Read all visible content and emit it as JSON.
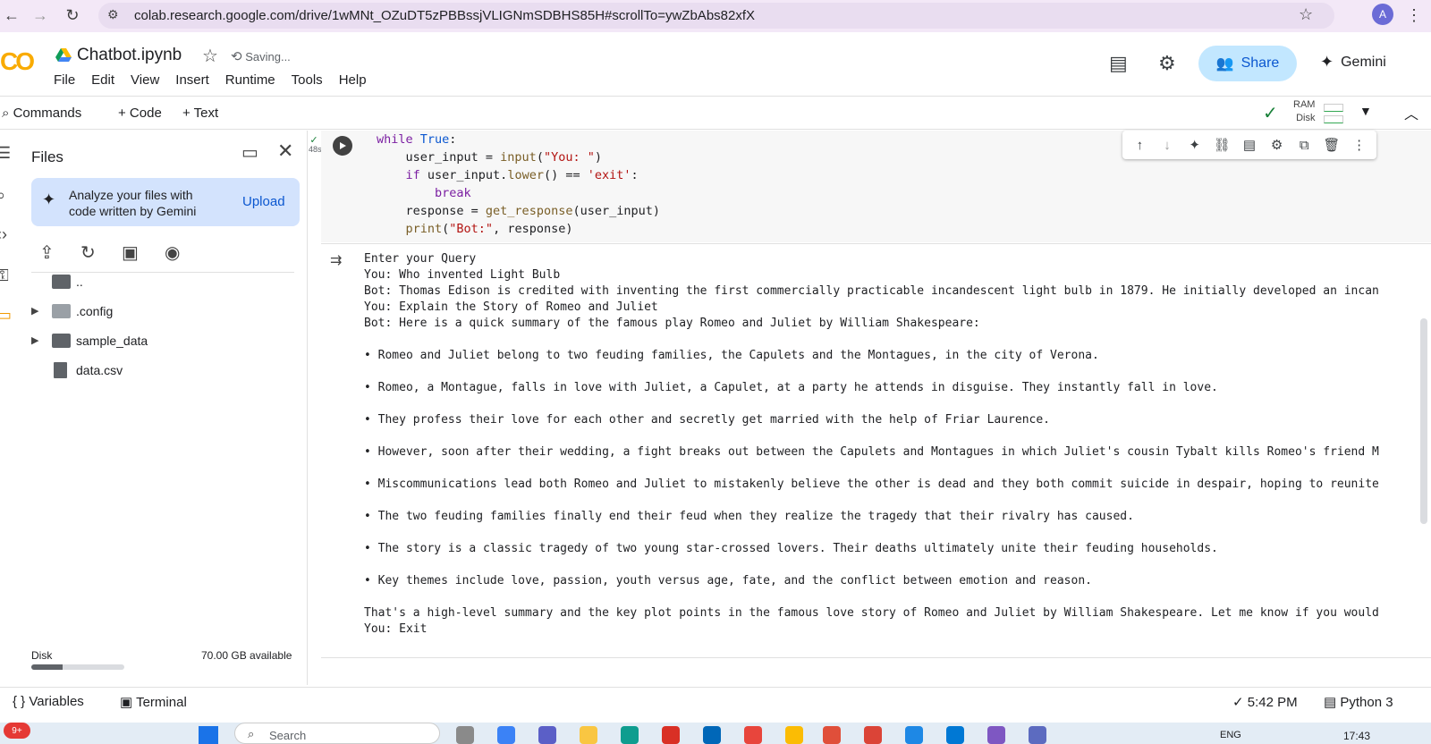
{
  "browser": {
    "url": "colab.research.google.com/drive/1wMNt_OZuDT5zPBBssjVLIGNmSDBHS85H#scrollTo=ywZbAbs82xfX",
    "profile_initial": "A"
  },
  "header": {
    "logo": "CO",
    "notebook_title": "Chatbot.ipynb",
    "saving_status": "Saving...",
    "menu": [
      "File",
      "Edit",
      "View",
      "Insert",
      "Runtime",
      "Tools",
      "Help"
    ],
    "share_label": "Share",
    "gemini_label": "Gemini"
  },
  "toolbar": {
    "commands_label": "Commands",
    "add_code_label": "+ Code",
    "add_text_label": "+ Text",
    "ram_label": "RAM",
    "disk_label": "Disk"
  },
  "files_panel": {
    "title": "Files",
    "gemini_card_text": "Analyze your files with code written by Gemini",
    "upload_label": "Upload",
    "tree": [
      {
        "label": "..",
        "type": "folder",
        "expandable": false
      },
      {
        "label": ".config",
        "type": "folder",
        "expandable": true
      },
      {
        "label": "sample_data",
        "type": "folder",
        "expandable": true
      },
      {
        "label": "data.csv",
        "type": "file",
        "expandable": false
      }
    ],
    "disk_label": "Disk",
    "disk_available": "70.00 GB available",
    "disk_used_fraction": 0.34
  },
  "cell": {
    "exec_time": "48s",
    "code_lines": [
      "while True:",
      "    user_input = input(\"You: \")",
      "    if user_input.lower() == 'exit':",
      "        break",
      "    response = get_response(user_input)",
      "    print(\"Bot:\", response)"
    ],
    "output_lines": [
      "Enter your Query",
      "You: Who invented Light Bulb",
      "Bot: Thomas Edison is credited with inventing the first commercially practicable incandescent light bulb in 1879. He initially developed an incan",
      "You: Explain the Story of Romeo and Juliet",
      "Bot: Here is a quick summary of the famous play Romeo and Juliet by William Shakespeare:",
      "",
      "• Romeo and Juliet belong to two feuding families, the Capulets and the Montagues, in the city of Verona.",
      "",
      "• Romeo, a Montague, falls in love with Juliet, a Capulet, at a party he attends in disguise. They instantly fall in love.",
      "",
      "• They profess their love for each other and secretly get married with the help of Friar Laurence.",
      "",
      "• However, soon after their wedding, a fight breaks out between the Capulets and Montagues in which Juliet's cousin Tybalt kills Romeo's friend M",
      "",
      "• Miscommunications lead both Romeo and Juliet to mistakenly believe the other is dead and they both commit suicide in despair, hoping to reunite",
      "",
      "• The two feuding families finally end their feud when they realize the tragedy that their rivalry has caused.",
      "",
      "• The story is a classic tragedy of two young star-crossed lovers. Their deaths ultimately unite their feuding households.",
      "",
      "• Key themes include love, passion, youth versus age, fate, and the conflict between emotion and reason.",
      "",
      "That's a high-level summary and the key plot points in the famous love story of Romeo and Juliet by William Shakespeare. Let me know if you would",
      "You: Exit"
    ]
  },
  "statusbar": {
    "variables_label": "Variables",
    "terminal_label": "Terminal",
    "time": "5:42 PM",
    "runtime": "Python 3"
  },
  "taskbar": {
    "notification_badge": "9+",
    "search_placeholder": "Search",
    "language": "ENG",
    "clock": "17:43"
  },
  "colors": {
    "accent": "#0b57d0",
    "share_bg": "#c2e7ff",
    "logo": "#f9ab00",
    "browser_bg": "#f3e8f7"
  }
}
